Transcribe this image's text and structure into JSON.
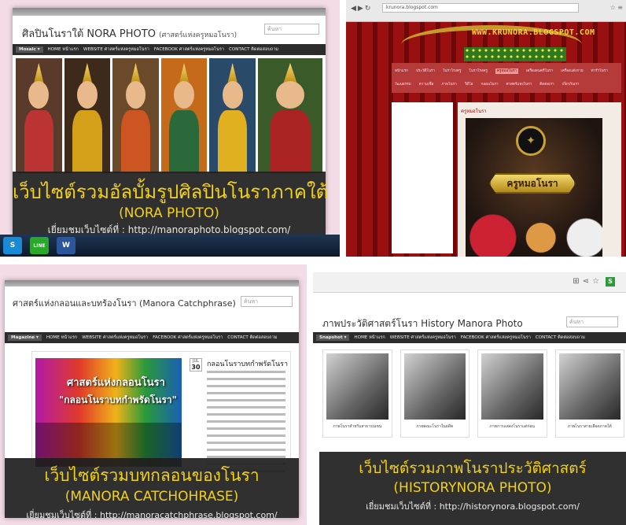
{
  "panels": {
    "nora_photo": {
      "page_title": "ศิลปินโนราใต้ NORA PHOTO",
      "page_subtitle": "(ศาสตร์แห่งครูหมอโนรา)",
      "search_placeholder": "ค้นหา",
      "nav": [
        "Mosaic ▾",
        "HOME หน้าแรก",
        "WEBSITE ศาสตร์แห่งครูหมอโนรา",
        "FACEBOOK ศาสตร์แห่งครูหมอโนรา",
        "CONTACT ติดต่อสอบถาม"
      ],
      "banner_line1": "เว็บไซต์รวมอัลบั้มรูปศิลปินโนราภาคใต้",
      "banner_line2": "(NORA PHOTO)",
      "banner_line3": "เยี่ยมชมเว็บไซต์ที่ : http://manoraphoto.blogspot.com/",
      "taskbar": [
        "S",
        "LINE",
        "W"
      ]
    },
    "krunora": {
      "url": "krunora.blogspot.com",
      "site_url_text": "WWW.KRUNORA.BLOGSPOT.COM",
      "content_title": "ครูหมอโนรา",
      "plaque": "ครูหมอโนรา",
      "menu": [
        "หน้าแรก",
        "ประวัติโนรา",
        "โนราโรงครู",
        "โนราโรงครู",
        "ครูหมอโนรา",
        "เครื่องดนตรีโนรา",
        "เครื่องแต่งกาย",
        "ท่ารำโนรา",
        "วัฒนธรรม",
        "ความเชื่อ",
        "ภาพโนรา",
        "วีดีโอ",
        "กลอนโนรา",
        "ศาสตร์แห่งโนรา",
        "ติดต่อเรา",
        "เกี่ยวกับเรา"
      ]
    },
    "manora_catchphrase": {
      "page_title": "ศาสตร์แห่งกลอนและบทร้องโนรา (Manora Catchphrase)",
      "search_placeholder": "ค้นหา",
      "nav": [
        "Magazine ▾",
        "HOME หน้าแรก",
        "WEBSITE ศาสตร์แห่งครูหมอโนรา",
        "FACEBOOK ศาสตร์แห่งครูหมอโนรา",
        "CONTACT ติดต่อสอบถาม"
      ],
      "image_line1": "ศาสตร์แห่งกลอนโนรา",
      "image_line2": "\"กลอนโนราบทกำพรัดโนรา\"",
      "date_month": "JUL",
      "date_day": "30",
      "post_title": "กลอนโนราบทกำพรัดโนรา",
      "banner_line1": "เว็บไซต์รวมบทกลอนของโนรา",
      "banner_line2": "(MANORA CATCHOHRASE)",
      "banner_line3": "เยี่ยมชมเว็บไซต์ที่ : http://manoracatchphrase.blogspot.com/"
    },
    "history_nora": {
      "page_title": "ภาพประวัติศาสตร์โนรา History Manora Photo",
      "search_placeholder": "ค้นหา",
      "nav": [
        "Snapshot ▾",
        "HOME หน้าแรก",
        "WEBSITE ศาสตร์แห่งครูหมอโนรา",
        "FACEBOOK ศาสตร์แห่งครูหมอโนรา",
        "CONTACT ติดต่อสอบถาม"
      ],
      "badge": "S",
      "captions": [
        "ภาพโนราสำหรับสาธารณชน",
        "ภาพคณะโนราในอดีต",
        "ภาพการแสดงโนราแต่ก่อน",
        "ภาพโนราสายเลือดภาคใต้"
      ],
      "banner_line1": "เว็บไซต์รวมภาพโนราประวัติศาสตร์",
      "banner_line2": "(HISTORYNORA PHOTO)",
      "banner_line3": "เยี่ยมชมเว็บไซต์ที่ : http://historynora.blogspot.com/"
    }
  },
  "colors": {
    "banner_text": "#f2d11a",
    "nav_bg": "#2c2c2c",
    "curtain_red": "#9a0f10",
    "frame_pink": "#f3dce6"
  }
}
